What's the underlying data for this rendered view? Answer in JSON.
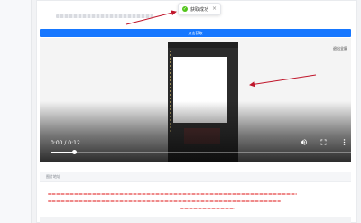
{
  "toast": {
    "text": "获取成功",
    "status_color": "#52c41a"
  },
  "toolbar": {
    "primary_button_label": "点击获取"
  },
  "video": {
    "time": "0:00 / 0:12",
    "progress_fraction": 0.08,
    "fullscreen_exit_label": "退出全屏",
    "icons": [
      "volume-icon",
      "fullscreen-icon",
      "more-icon"
    ]
  },
  "image_section": {
    "label": "图片地址"
  },
  "colors": {
    "primary": "#1677ff",
    "annotation_arrow": "#c0162b"
  }
}
